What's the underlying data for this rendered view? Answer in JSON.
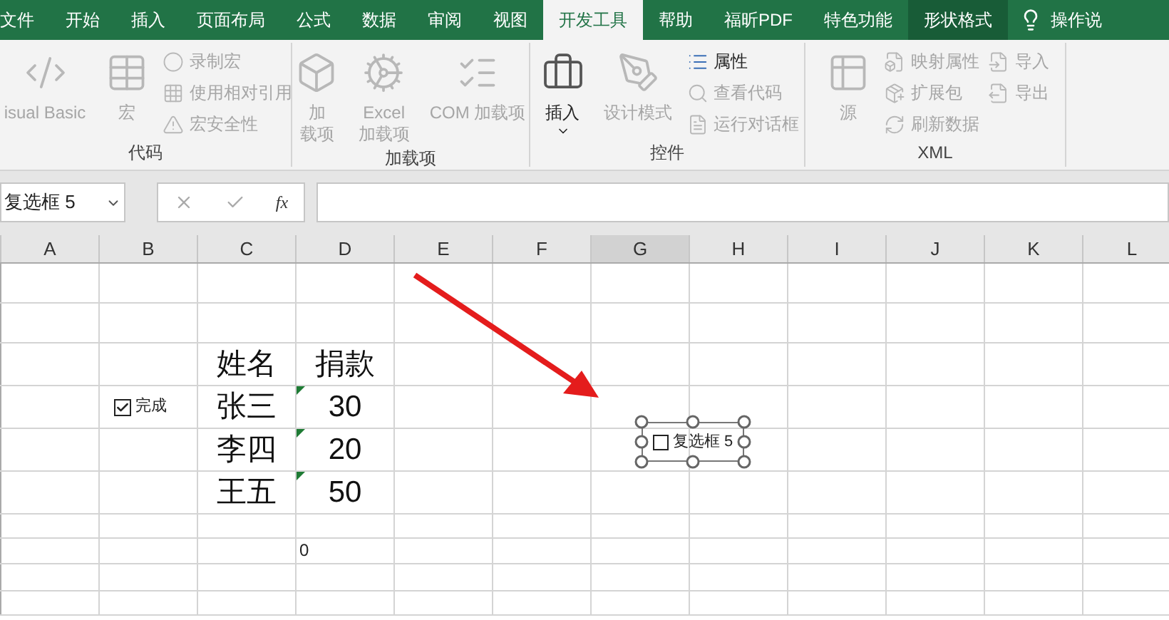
{
  "tabs": [
    {
      "label": "文件",
      "selected": false,
      "highlighted": false
    },
    {
      "label": "开始",
      "selected": false,
      "highlighted": false
    },
    {
      "label": "插入",
      "selected": false,
      "highlighted": false
    },
    {
      "label": "页面布局",
      "selected": false,
      "highlighted": false
    },
    {
      "label": "公式",
      "selected": false,
      "highlighted": false
    },
    {
      "label": "数据",
      "selected": false,
      "highlighted": false
    },
    {
      "label": "审阅",
      "selected": false,
      "highlighted": false
    },
    {
      "label": "视图",
      "selected": false,
      "highlighted": false
    },
    {
      "label": "开发工具",
      "selected": true,
      "highlighted": false
    },
    {
      "label": "帮助",
      "selected": false,
      "highlighted": false
    },
    {
      "label": "福昕PDF",
      "selected": false,
      "highlighted": false
    },
    {
      "label": "特色功能",
      "selected": false,
      "highlighted": false
    },
    {
      "label": "形状格式",
      "selected": false,
      "highlighted": true
    }
  ],
  "tell_me": "操作说",
  "ribbon": {
    "groups": [
      {
        "label": "代码",
        "columns": [
          {
            "kind": "large",
            "items": [
              {
                "lines": [
                  "isual Basic"
                ],
                "disabled": true
              }
            ]
          },
          {
            "kind": "large",
            "items": [
              {
                "lines": [
                  "宏"
                ],
                "disabled": true
              }
            ]
          },
          {
            "kind": "small",
            "items": [
              {
                "label": "录制宏",
                "disabled": true
              },
              {
                "label": "使用相对引用",
                "disabled": true
              },
              {
                "label": "宏安全性",
                "disabled": true
              }
            ]
          }
        ]
      },
      {
        "label": "加载项",
        "columns": [
          {
            "kind": "large",
            "items": [
              {
                "lines": [
                  "加",
                  "载项"
                ],
                "disabled": true
              }
            ]
          },
          {
            "kind": "large",
            "items": [
              {
                "lines": [
                  "Excel",
                  "加载项"
                ],
                "disabled": true
              }
            ]
          },
          {
            "kind": "large",
            "items": [
              {
                "lines": [
                  "COM 加载项"
                ],
                "disabled": true
              }
            ]
          }
        ]
      },
      {
        "label": "控件",
        "columns": [
          {
            "kind": "large",
            "items": [
              {
                "lines": [
                  "插入"
                ],
                "disabled": false,
                "dropdown": true
              }
            ]
          },
          {
            "kind": "large",
            "items": [
              {
                "lines": [
                  "设计模式"
                ],
                "disabled": true
              }
            ]
          },
          {
            "kind": "small",
            "items": [
              {
                "label": "属性",
                "disabled": false
              },
              {
                "label": "查看代码",
                "disabled": true
              },
              {
                "label": "运行对话框",
                "disabled": true
              }
            ]
          }
        ]
      },
      {
        "label": "XML",
        "columns": [
          {
            "kind": "large",
            "items": [
              {
                "lines": [
                  "源"
                ],
                "disabled": true
              }
            ]
          },
          {
            "kind": "small",
            "items": [
              {
                "label": "映射属性",
                "disabled": true
              },
              {
                "label": "扩展包",
                "disabled": true
              },
              {
                "label": "刷新数据",
                "disabled": true
              }
            ]
          },
          {
            "kind": "small",
            "items": [
              {
                "label": "导入",
                "disabled": true
              },
              {
                "label": "导出",
                "disabled": true
              }
            ]
          }
        ]
      }
    ]
  },
  "formula_bar": {
    "name_box": "复选框 5",
    "function_label": "fx"
  },
  "columns": [
    "A",
    "B",
    "C",
    "D",
    "E",
    "F",
    "G",
    "H",
    "I",
    "J",
    "K",
    "L"
  ],
  "rows": [
    {},
    {},
    {
      "c": {
        "text": "姓名",
        "large": true
      },
      "d": {
        "text": "捐款",
        "large": true
      }
    },
    {
      "b": {
        "kind": "checkbox",
        "label": "完成",
        "checked": true
      },
      "c": {
        "text": "张三",
        "large": true
      },
      "d": {
        "text": "30",
        "large": true,
        "flag": true
      }
    },
    {
      "c": {
        "text": "李四",
        "large": true
      },
      "d": {
        "text": "20",
        "large": true,
        "flag": true
      }
    },
    {
      "c": {
        "text": "王五",
        "large": true
      },
      "d": {
        "text": "50",
        "large": true,
        "flag": true
      }
    },
    {},
    {
      "d": {
        "text": "0",
        "large": false
      }
    },
    {},
    {}
  ],
  "floating_checkbox": {
    "label": "复选框 5",
    "checked": false,
    "selected": true
  }
}
